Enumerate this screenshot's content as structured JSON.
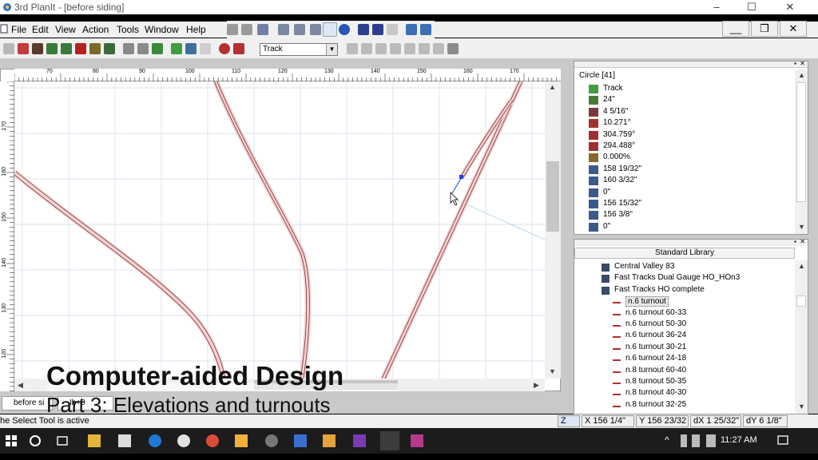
{
  "window": {
    "title": "3rd PlanIt - [before siding]",
    "controls": {
      "minimize": "–",
      "maximize": "☐",
      "close": "✕"
    }
  },
  "menu": {
    "items": [
      "File",
      "Edit",
      "View",
      "Action",
      "Tools",
      "Window",
      "Help"
    ],
    "mdi_controls": {
      "minimize": "__",
      "restore": "❐",
      "close": "✕"
    }
  },
  "toolbar": {
    "layer_select": {
      "value": "Track"
    }
  },
  "ruler": {
    "horizontal_ticks": [
      "70",
      "80",
      "90",
      "100",
      "110",
      "120",
      "130",
      "140",
      "150",
      "160",
      "170"
    ],
    "vertical_ticks": [
      "170",
      "160",
      "150",
      "140",
      "130",
      "120"
    ]
  },
  "tabs": [
    {
      "label": "before si"
    },
    {
      "label": "Ib+0"
    }
  ],
  "properties": {
    "header": "Circle [41]",
    "rows": [
      {
        "icon": "layer-icon",
        "value": "Track"
      },
      {
        "icon": "radius-icon",
        "value": "24\""
      },
      {
        "icon": "arc-length-icon",
        "value": "4 5/16\""
      },
      {
        "icon": "angle-icon",
        "value": "10.271°"
      },
      {
        "icon": "start-angle-icon",
        "value": "304.759°"
      },
      {
        "icon": "end-angle-icon",
        "value": "294.488°"
      },
      {
        "icon": "grade-icon",
        "value": "0.000%"
      },
      {
        "icon": "x1-icon",
        "value": "158 19/32\""
      },
      {
        "icon": "y1-icon",
        "value": "160 3/32\""
      },
      {
        "icon": "z1-icon",
        "value": "0\""
      },
      {
        "icon": "x2-icon",
        "value": "156 15/32\""
      },
      {
        "icon": "y2-icon",
        "value": "156 3/8\""
      },
      {
        "icon": "z2-icon",
        "value": "0\""
      }
    ]
  },
  "library": {
    "title": "Standard Library",
    "items": [
      {
        "label": "Central Valley 83",
        "kind": "folder",
        "indent": 1
      },
      {
        "label": "Fast Tracks Dual Gauge HO_HOn3",
        "kind": "folder",
        "indent": 1
      },
      {
        "label": "Fast Tracks HO complete",
        "kind": "folder",
        "indent": 1
      },
      {
        "label": "n.6 turnout",
        "kind": "item",
        "indent": 2,
        "selected": true
      },
      {
        "label": "n.6 turnout 60-33",
        "kind": "item",
        "indent": 2
      },
      {
        "label": "n.6 turnout 50-30",
        "kind": "item",
        "indent": 2
      },
      {
        "label": "n.6 turnout 36-24",
        "kind": "item",
        "indent": 2
      },
      {
        "label": "n.6 turnout 30-21",
        "kind": "item",
        "indent": 2
      },
      {
        "label": "n.6 turnout 24-18",
        "kind": "item",
        "indent": 2
      },
      {
        "label": "n.8 turnout 60-40",
        "kind": "item",
        "indent": 2
      },
      {
        "label": "n.8 turnout 50-35",
        "kind": "item",
        "indent": 2
      },
      {
        "label": "n.8 turnout 40-30",
        "kind": "item",
        "indent": 2
      },
      {
        "label": "n.8 turnout 32-25",
        "kind": "item",
        "indent": 2
      }
    ]
  },
  "status": {
    "message": "he Select Tool is active",
    "z_indicator": "Z",
    "x": "X 156 1/4\"",
    "y": "Y 156 23/32",
    "dx": "dX 1 25/32\"",
    "dy": "dY 6 1/8\""
  },
  "taskbar": {
    "clock": "11:27 AM"
  },
  "overlay": {
    "title": "Computer-aided Design",
    "subtitle": "Part 3: Elevations and turnouts"
  },
  "colors": {
    "track_rail": "#8b2a2a",
    "track_bed": "#f1d4d4",
    "grid": "#cfd8e8",
    "selection": "#2a3fd8"
  }
}
